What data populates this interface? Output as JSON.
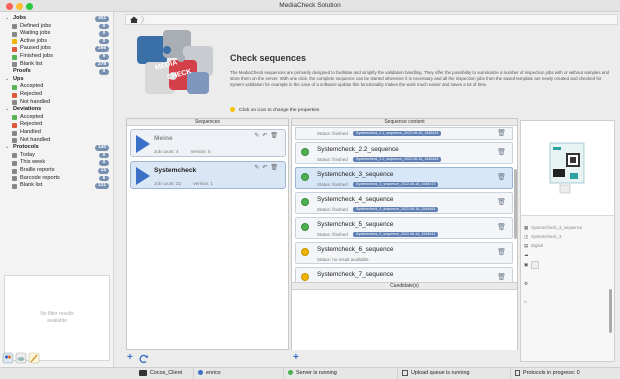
{
  "window": {
    "title": "MediaCheck Solution"
  },
  "sidebar": {
    "items": [
      {
        "kind": "group",
        "label": "Jobs",
        "count": "302",
        "chev": "⌄"
      },
      {
        "kind": "sub",
        "label": "Defined jobs",
        "count": "0",
        "color": "#888"
      },
      {
        "kind": "sub",
        "label": "Waiting jobs",
        "count": "0",
        "color": "#888"
      },
      {
        "kind": "sub",
        "label": "Active jobs",
        "count": "0",
        "color": "#f0b400"
      },
      {
        "kind": "sub",
        "label": "Paused jobs",
        "count": "296",
        "color": "#e05a3a"
      },
      {
        "kind": "sub",
        "label": "Finished jobs",
        "count": "5",
        "color": "#56b356"
      },
      {
        "kind": "sub",
        "label": "Blank list",
        "count": "278",
        "color": "#8a8a8a"
      },
      {
        "kind": "group",
        "label": "Proofs",
        "count": "0",
        "chev": ""
      },
      {
        "kind": "group",
        "label": "Ups",
        "count": "",
        "chev": "⌄"
      },
      {
        "kind": "sub",
        "label": "Accepted",
        "count": "",
        "color": "#56b356"
      },
      {
        "kind": "sub",
        "label": "Rejected",
        "count": "",
        "color": "#e05a3a"
      },
      {
        "kind": "sub",
        "label": "Not handled",
        "count": "",
        "color": "#888"
      },
      {
        "kind": "group",
        "label": "Deviations",
        "count": "",
        "chev": "⌄"
      },
      {
        "kind": "sub",
        "label": "Accepted",
        "count": "",
        "color": "#56b356"
      },
      {
        "kind": "sub",
        "label": "Rejected",
        "count": "",
        "color": "#e05a3a"
      },
      {
        "kind": "sub",
        "label": "Handled",
        "count": "",
        "color": "#888"
      },
      {
        "kind": "sub",
        "label": "Not handled",
        "count": "",
        "color": "#888"
      },
      {
        "kind": "group",
        "label": "Protocols",
        "count": "140",
        "chev": "⌄"
      },
      {
        "kind": "sub",
        "label": "Today",
        "count": "0",
        "color": "#888"
      },
      {
        "kind": "sub",
        "label": "This week",
        "count": "0",
        "color": "#888"
      },
      {
        "kind": "sub",
        "label": "Braille reports",
        "count": "15",
        "color": "#888"
      },
      {
        "kind": "sub",
        "label": "Barcode reports",
        "count": "6",
        "color": "#888"
      },
      {
        "kind": "sub",
        "label": "Blank list",
        "count": "131",
        "color": "#888"
      }
    ],
    "no_filter_line1": "No filter results",
    "no_filter_line2": "available"
  },
  "header": {
    "title": "Check sequences",
    "description": "The MediaCheck sequences are primarily designed to facilitate and simplify the validation handling. They offer the possibility to summarize a number of inspection jobs with or without samples and store them on the server. With one click, the complete sequence can be started whenever it is necessary and all the inspection jobs from the saved template are newly created and checked for system validation for example in the case of a software update this functionality makes the work much easier and saves a lot of time.",
    "hint": "Click on icon to change the properties"
  },
  "sequences": {
    "header": "Sequences",
    "items": [
      {
        "name": "Meine",
        "job_count": "Job count: 4",
        "version": "Version: 5",
        "selected": false,
        "dim": true
      },
      {
        "name": "Systemcheck",
        "job_count": "Job count: 22",
        "version": "Version: 1",
        "selected": true,
        "dim": false
      }
    ]
  },
  "content": {
    "header": "Sequence content",
    "top_status": "Status: finished",
    "top_tag": "Systemcheck_2.1_sequence_2022-06-16_1545433",
    "items": [
      {
        "name": "Systemcheck_2.2_sequence",
        "status": "Status: finished",
        "tag": "Systemcheck_2.2_sequence_2022-06-16_1545453",
        "state": "green",
        "selected": false
      },
      {
        "name": "Systemcheck_3_sequence",
        "status": "Status: finished",
        "tag": "Systemcheck_3_sequence_2022-06-16_1545473",
        "state": "green",
        "selected": true
      },
      {
        "name": "Systemcheck_4_sequence",
        "status": "Status: finished",
        "tag": "Systemcheck_4_sequence_2022-06-16_1545493",
        "state": "green",
        "selected": false
      },
      {
        "name": "Systemcheck_5_sequence",
        "status": "Status: finished",
        "tag": "Systemcheck_5_sequence_2022-06-16_1545513",
        "state": "green",
        "selected": false
      },
      {
        "name": "Systemcheck_6_sequence",
        "status": "Status: no result available",
        "tag": "",
        "state": "yellow",
        "selected": false
      },
      {
        "name": "Systemcheck_7_sequence",
        "status": "Status: no result available",
        "tag": "",
        "state": "yellow",
        "selected": false
      }
    ],
    "candidates_header": "Candidate(s)"
  },
  "preview": {
    "info": [
      "Systemcheck_3_sequence",
      "Systemcheck_3",
      "Digital"
    ]
  },
  "status": {
    "client": "Cocos_Client",
    "user": "enrico",
    "server": "Server is running",
    "upload": "Upload queue is running",
    "protocols": "Protocols in progress: 0"
  },
  "colors": {
    "accent": "#3a6fc7",
    "green": "#4caf50",
    "yellow": "#f0b400"
  }
}
